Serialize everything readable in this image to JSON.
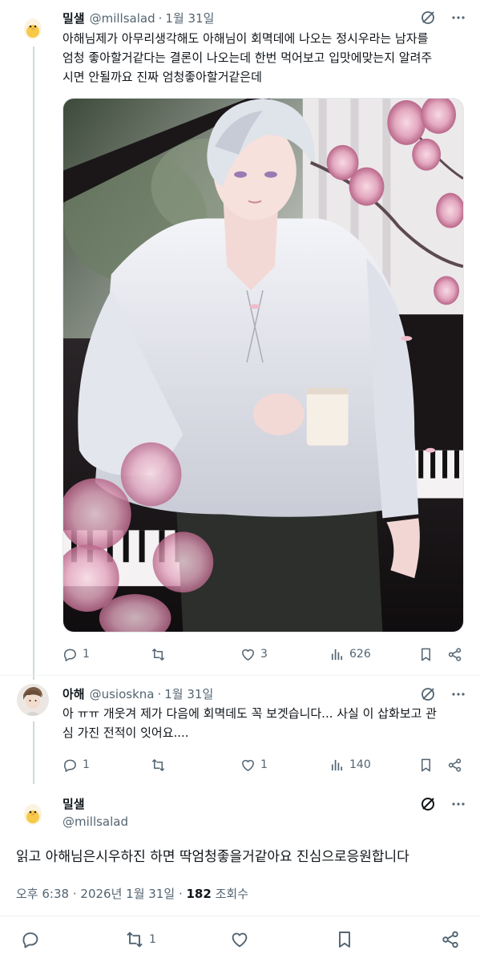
{
  "tweet1": {
    "name": "밀샐",
    "handle": "@millsalad",
    "dot": "·",
    "date": "1월 31일",
    "text_line1": "아해님제가 아무리생각해도 아해님이 회멱데에 나오는 정시우라는 남자를",
    "text_line2": "엄청 좋아할거같다는 결론이 나오는데 한번 먹어보고 입맛에맞는지 알려주",
    "text_line3": "시면 안될까요 진짜 엄청좋아할거같은데",
    "replies": "1",
    "likes": "3",
    "views": "626"
  },
  "tweet2": {
    "name": "아해",
    "handle": "@usiosknа",
    "dot": "·",
    "date": "1월 31일",
    "text_line1": "아 ㅠㅠ 개웃겨 제가 다음에 회멱데도 꼭 보겟습니다... 사실 이 삽화보고 관",
    "text_line2": "심 가진 전적이 잇어요....",
    "replies": "1",
    "likes": "1",
    "views": "140"
  },
  "main_tweet": {
    "name": "밀샐",
    "handle": "@millsalad",
    "text": "읽고 아해님은시우하진  하면  딱엄청좋을거같아요  진심으로응원합니다",
    "time": "오후 6:38",
    "dot": "·",
    "date": "2026년 1월 31일",
    "dot2": "·",
    "views": "182",
    "views_label": "조회수",
    "retweets": "1"
  },
  "icons": {
    "reply": "reply-icon",
    "retweet": "retweet-icon",
    "like": "heart-icon",
    "views": "views-chart-icon",
    "bookmark": "bookmark-icon",
    "share": "share-icon",
    "grok": "grok-icon",
    "more": "more-icon"
  },
  "colors": {
    "text": "#0f1419",
    "secondary": "#536471",
    "thread_line": "#cfd9de"
  }
}
